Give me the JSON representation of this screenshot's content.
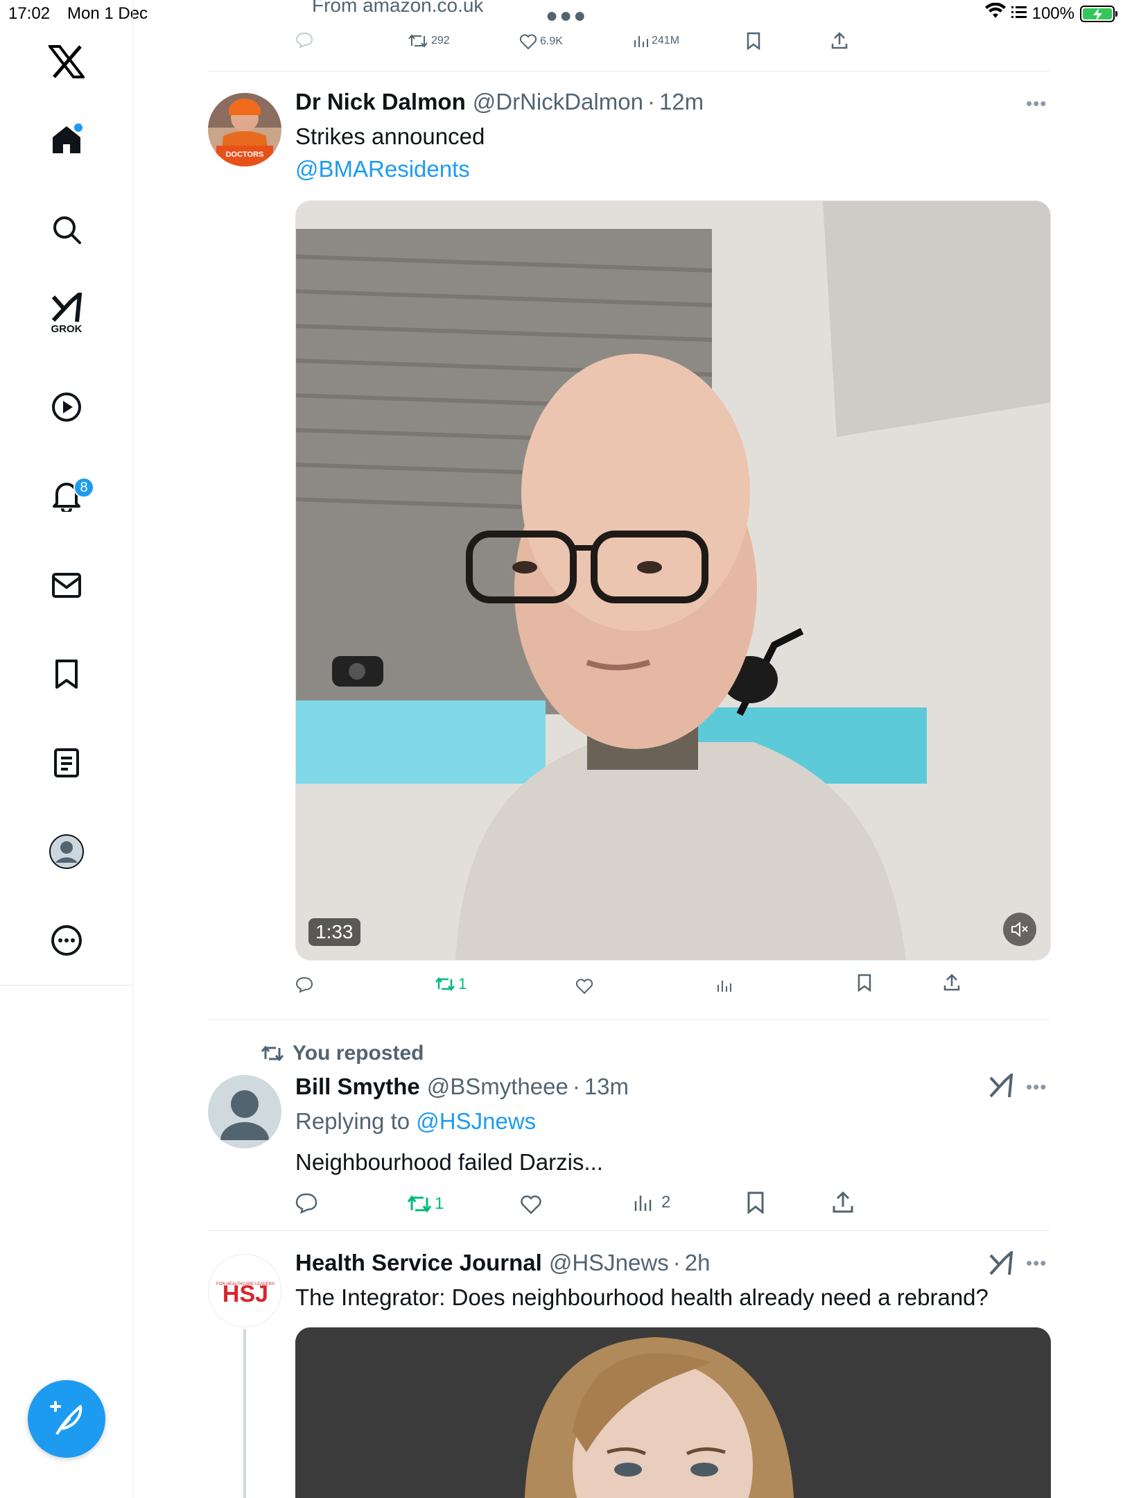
{
  "status_bar": {
    "time": "17:02",
    "date": "Mon 1 Dec",
    "battery": "100%"
  },
  "sidebar": {
    "grok_label": "GROK",
    "notifications_count": "8"
  },
  "previous_tweet": {
    "source": "From amazon.co.uk",
    "retweets": "292",
    "likes": "6.9K",
    "views": "241M"
  },
  "tweet1": {
    "name": "Dr Nick Dalmon",
    "handle": "@DrNickDalmon",
    "time": "12m",
    "text": "Strikes announced",
    "mention": "@BMAResidents",
    "avatar_badge": "DOCTORS",
    "video_duration": "1:33",
    "retweets": "1"
  },
  "tweet2": {
    "repost_label": "You reposted",
    "name": "Bill Smythe",
    "handle": "@BSmytheee",
    "time": "13m",
    "replying_prefix": "Replying to",
    "replying_to": "@HSJnews",
    "text": "Neighbourhood failed Darzis...",
    "retweets": "1",
    "views": "2"
  },
  "tweet3": {
    "name": "Health Service Journal",
    "handle": "@HSJnews",
    "time": "2h",
    "text": "The Integrator: Does neighbourhood health already need a rebrand?",
    "logo_text": "HSJ",
    "logo_tagline": "FOR HEALTHCARE LEADERS"
  },
  "colors": {
    "accent": "#1d9bf0",
    "repost_green": "#00ba7c",
    "secondary_text": "#536471"
  }
}
